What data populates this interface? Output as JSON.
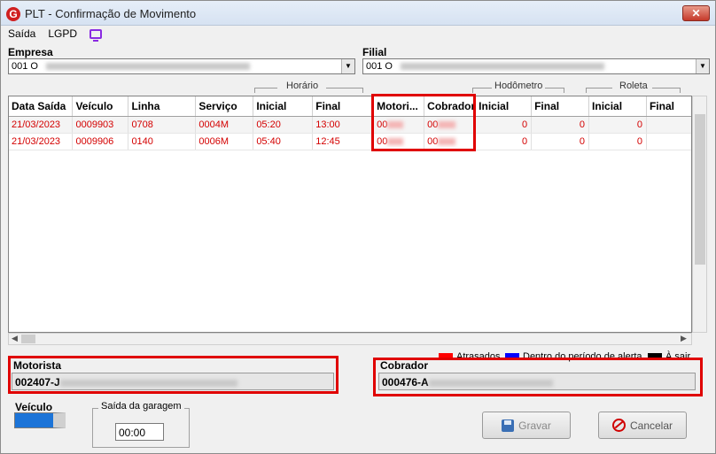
{
  "window": {
    "title": "PLT - Confirmação de Movimento",
    "close_label": "✕"
  },
  "menu": {
    "items": [
      "Saída",
      "LGPD"
    ]
  },
  "empresa": {
    "label": "Empresa",
    "value": "001 O"
  },
  "filial": {
    "label": "Filial",
    "value": "001 O"
  },
  "groups": {
    "horario": "Horário",
    "hodometro": "Hodômetro",
    "roleta": "Roleta"
  },
  "grid": {
    "columns": [
      "Data Saída",
      "Veículo",
      "Linha",
      "Serviço",
      "Inicial",
      "Final",
      "Motori...",
      "Cobrador",
      "Inicial",
      "Final",
      "Inicial",
      "Final"
    ],
    "rows": [
      [
        "21/03/2023",
        "0009903",
        "0708",
        "0004M",
        "05:20",
        "13:00",
        "00",
        "00",
        "0",
        "0",
        "0",
        ""
      ],
      [
        "21/03/2023",
        "0009906",
        "0140",
        "0006M",
        "05:40",
        "12:45",
        "00",
        "00",
        "0",
        "0",
        "0",
        ""
      ]
    ]
  },
  "legend": [
    {
      "label": "Atrasados",
      "color": "#ff0000"
    },
    {
      "label": "Dentro do período de alerta",
      "color": "#0000ff"
    },
    {
      "label": "À sair",
      "color": "#000000"
    }
  ],
  "motorista": {
    "label": "Motorista",
    "value": "002407-J"
  },
  "cobrador": {
    "label": "Cobrador",
    "value": "000476-A"
  },
  "veiculo": {
    "label": "Veículo",
    "color": "#1c74d8"
  },
  "saida_garagem": {
    "label": "Saída da garagem",
    "value": "00:00"
  },
  "buttons": {
    "gravar": "Gravar",
    "cancelar": "Cancelar"
  },
  "colors": {
    "highlight": "#e00000",
    "row_text": "#d40000"
  }
}
